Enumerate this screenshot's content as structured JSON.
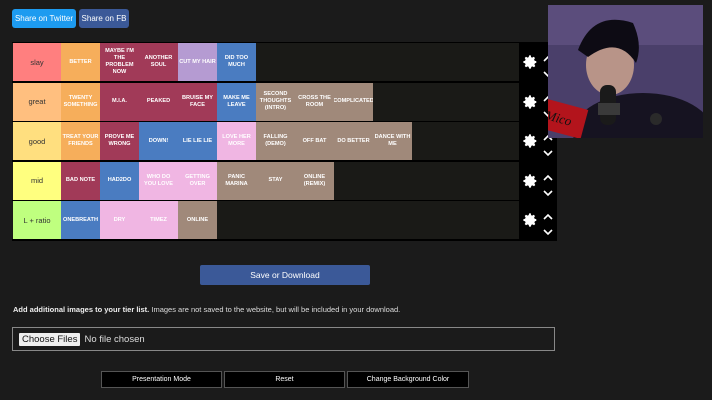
{
  "share": {
    "twitter_label": "Share on Twitter",
    "fb_label": "Share on FB"
  },
  "tiers": [
    {
      "label": "slay",
      "color": "#ff7f7f",
      "items": [
        {
          "text": "BETTER",
          "color": "#f6ae5b"
        },
        {
          "text": "MAYBE I'M THE PROBLEM NOW",
          "color": "#a13a58"
        },
        {
          "text": "ANOTHER SOUL",
          "color": "#a13a58"
        },
        {
          "text": "CUT MY HAIR",
          "color": "#b59bd2"
        },
        {
          "text": "DID TOO MUCH",
          "color": "#4a7cc1"
        }
      ]
    },
    {
      "label": "great",
      "color": "#ffbf7f",
      "items": [
        {
          "text": "TWENTY SOMETHING",
          "color": "#f6ae5b"
        },
        {
          "text": "M.I.A.",
          "color": "#a13a58"
        },
        {
          "text": "PEAKED",
          "color": "#a13a58"
        },
        {
          "text": "BRUISE MY FACE",
          "color": "#a13a58"
        },
        {
          "text": "MAKE ME LEAVE",
          "color": "#4a7cc1"
        },
        {
          "text": "SECOND THOUGHTS (INTRO)",
          "color": "#a0897a"
        },
        {
          "text": "CROSS THE ROOM",
          "color": "#a0897a"
        },
        {
          "text": "COMPLICATED",
          "color": "#a0897a"
        }
      ]
    },
    {
      "label": "good",
      "color": "#ffdf7f",
      "items": [
        {
          "text": "TREAT YOUR FRIENDS",
          "color": "#f6ae5b"
        },
        {
          "text": "PROVE ME WRONG",
          "color": "#a13a58"
        },
        {
          "text": "DOWN!",
          "color": "#4a7cc1"
        },
        {
          "text": "LIE LIE LIE",
          "color": "#4a7cc1"
        },
        {
          "text": "LOVE HER MORE",
          "color": "#f0b6e3"
        },
        {
          "text": "FALLING (DEMO)",
          "color": "#a0897a"
        },
        {
          "text": "OFF BAT",
          "color": "#a0897a"
        },
        {
          "text": "DO BETTER",
          "color": "#a0897a"
        },
        {
          "text": "DANCE WITH ME",
          "color": "#a0897a"
        }
      ]
    },
    {
      "label": "mid",
      "color": "#ffff7f",
      "items": [
        {
          "text": "BAD NOTE",
          "color": "#a13a58"
        },
        {
          "text": "HAD2DO",
          "color": "#4a7cc1"
        },
        {
          "text": "WHO DO YOU LOVE",
          "color": "#f0b6e3"
        },
        {
          "text": "GETTING OVER",
          "color": "#f0b6e3"
        },
        {
          "text": "PANIC MARINA",
          "color": "#a0897a"
        },
        {
          "text": "STAY",
          "color": "#a0897a"
        },
        {
          "text": "ONLINE (REMIX)",
          "color": "#a0897a"
        }
      ]
    },
    {
      "label": "L + ratio",
      "color": "#bfff7f",
      "items": [
        {
          "text": "ONEBREATH",
          "color": "#4a7cc1"
        },
        {
          "text": "DRY",
          "color": "#f0b6e3"
        },
        {
          "text": "TIMEZ",
          "color": "#f0b6e3"
        },
        {
          "text": "ONLINE",
          "color": "#a0897a"
        }
      ]
    }
  ],
  "save_label": "Save or Download",
  "info": {
    "bold": "Add additional images to your tier list.",
    "rest": " Images are not saved to the website, but will be included in your download."
  },
  "file_input": {
    "button_label": "Choose Files",
    "status": "No file chosen"
  },
  "buttons": {
    "presentation": "Presentation Mode",
    "reset": "Reset",
    "change_background": "Change Background Color"
  },
  "webcam": {
    "sign_text": "Mico"
  }
}
